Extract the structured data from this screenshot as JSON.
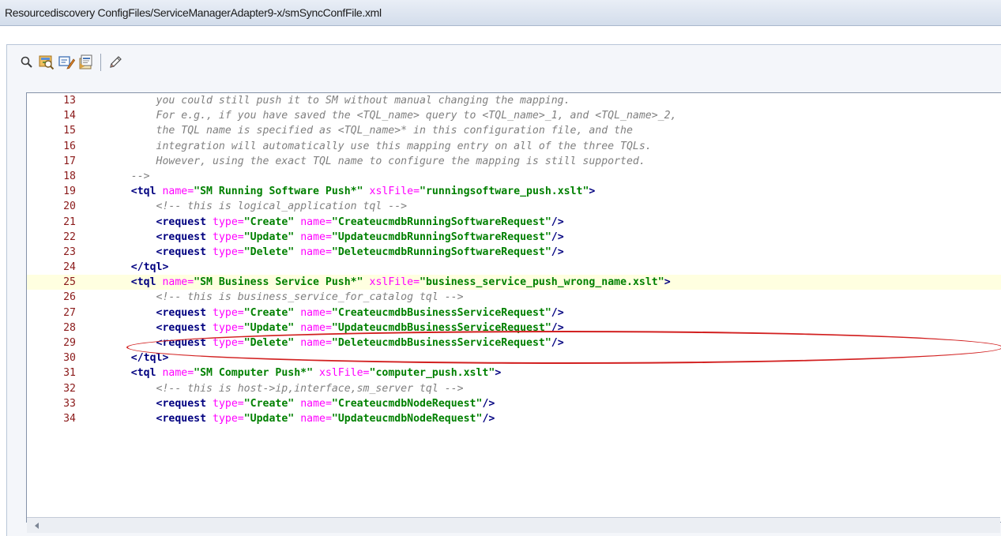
{
  "window": {
    "path": "Resourcediscovery ConfigFiles/ServiceManagerAdapter9-x/smSyncConfFile.xml"
  },
  "toolbar": {
    "buttons": [
      {
        "name": "search-icon"
      },
      {
        "name": "find-replace-icon"
      },
      {
        "name": "comment-icon"
      },
      {
        "name": "properties-icon"
      },
      {
        "name": "edit-pencil-icon"
      }
    ]
  },
  "editor": {
    "highlight_line": 25,
    "annotation_line": 25,
    "lines": [
      {
        "num": "13",
        "segments": [
          {
            "t": "comment",
            "s": "        you could still push it to SM without manual changing the mapping."
          }
        ]
      },
      {
        "num": "14",
        "segments": [
          {
            "t": "comment",
            "s": "        For e.g., if you have saved the <TQL_name> query to <TQL_name>_1, and <TQL_name>_2,"
          }
        ]
      },
      {
        "num": "15",
        "segments": [
          {
            "t": "comment",
            "s": "        the TQL name is specified as <TQL_name>* in this configuration file, and the"
          }
        ]
      },
      {
        "num": "16",
        "segments": [
          {
            "t": "comment",
            "s": "        integration will automatically use this mapping entry on all of the three TQLs."
          }
        ]
      },
      {
        "num": "17",
        "segments": [
          {
            "t": "comment",
            "s": "        However, using the exact TQL name to configure the mapping is still supported."
          }
        ]
      },
      {
        "num": "18",
        "segments": [
          {
            "t": "comment",
            "s": "    -->"
          }
        ]
      },
      {
        "num": "19",
        "segments": [
          {
            "t": "plain",
            "s": "    "
          },
          {
            "t": "tag",
            "s": "<tql "
          },
          {
            "t": "attr",
            "s": "name="
          },
          {
            "t": "val",
            "s": "\"SM Running Software Push*\""
          },
          {
            "t": "plain",
            "s": " "
          },
          {
            "t": "attr",
            "s": "xslFile="
          },
          {
            "t": "val",
            "s": "\"runningsoftware_push.xslt\""
          },
          {
            "t": "tag",
            "s": ">"
          }
        ]
      },
      {
        "num": "20",
        "segments": [
          {
            "t": "comment",
            "s": "        <!-- this is logical_application tql -->"
          }
        ]
      },
      {
        "num": "21",
        "segments": [
          {
            "t": "plain",
            "s": "        "
          },
          {
            "t": "tag",
            "s": "<request "
          },
          {
            "t": "attr",
            "s": "type="
          },
          {
            "t": "val",
            "s": "\"Create\""
          },
          {
            "t": "plain",
            "s": " "
          },
          {
            "t": "attr",
            "s": "name="
          },
          {
            "t": "val",
            "s": "\"CreateucmdbRunningSoftwareRequest\""
          },
          {
            "t": "tag",
            "s": "/>"
          }
        ]
      },
      {
        "num": "22",
        "segments": [
          {
            "t": "plain",
            "s": "        "
          },
          {
            "t": "tag",
            "s": "<request "
          },
          {
            "t": "attr",
            "s": "type="
          },
          {
            "t": "val",
            "s": "\"Update\""
          },
          {
            "t": "plain",
            "s": " "
          },
          {
            "t": "attr",
            "s": "name="
          },
          {
            "t": "val",
            "s": "\"UpdateucmdbRunningSoftwareRequest\""
          },
          {
            "t": "tag",
            "s": "/>"
          }
        ]
      },
      {
        "num": "23",
        "segments": [
          {
            "t": "plain",
            "s": "        "
          },
          {
            "t": "tag",
            "s": "<request "
          },
          {
            "t": "attr",
            "s": "type="
          },
          {
            "t": "val",
            "s": "\"Delete\""
          },
          {
            "t": "plain",
            "s": " "
          },
          {
            "t": "attr",
            "s": "name="
          },
          {
            "t": "val",
            "s": "\"DeleteucmdbRunningSoftwareRequest\""
          },
          {
            "t": "tag",
            "s": "/>"
          }
        ]
      },
      {
        "num": "24",
        "segments": [
          {
            "t": "plain",
            "s": "    "
          },
          {
            "t": "tag",
            "s": "</tql>"
          }
        ]
      },
      {
        "num": "25",
        "segments": [
          {
            "t": "plain",
            "s": "    "
          },
          {
            "t": "tag",
            "s": "<tql "
          },
          {
            "t": "attr",
            "s": "name="
          },
          {
            "t": "val",
            "s": "\"SM Business Service Push*\""
          },
          {
            "t": "plain",
            "s": " "
          },
          {
            "t": "attr",
            "s": "xslFile="
          },
          {
            "t": "val",
            "s": "\"business_service_push_wrong_name.xslt\""
          },
          {
            "t": "tag",
            "s": ">"
          }
        ]
      },
      {
        "num": "26",
        "segments": [
          {
            "t": "comment",
            "s": "        <!-- this is business_service_for_catalog tql -->"
          }
        ]
      },
      {
        "num": "27",
        "segments": [
          {
            "t": "plain",
            "s": "        "
          },
          {
            "t": "tag",
            "s": "<request "
          },
          {
            "t": "attr",
            "s": "type="
          },
          {
            "t": "val",
            "s": "\"Create\""
          },
          {
            "t": "plain",
            "s": " "
          },
          {
            "t": "attr",
            "s": "name="
          },
          {
            "t": "val",
            "s": "\"CreateucmdbBusinessServiceRequest\""
          },
          {
            "t": "tag",
            "s": "/>"
          }
        ]
      },
      {
        "num": "28",
        "segments": [
          {
            "t": "plain",
            "s": "        "
          },
          {
            "t": "tag",
            "s": "<request "
          },
          {
            "t": "attr",
            "s": "type="
          },
          {
            "t": "val",
            "s": "\"Update\""
          },
          {
            "t": "plain",
            "s": " "
          },
          {
            "t": "attr",
            "s": "name="
          },
          {
            "t": "val",
            "s": "\"UpdateucmdbBusinessServiceRequest\""
          },
          {
            "t": "tag",
            "s": "/>"
          }
        ]
      },
      {
        "num": "29",
        "segments": [
          {
            "t": "plain",
            "s": "        "
          },
          {
            "t": "tag",
            "s": "<request "
          },
          {
            "t": "attr",
            "s": "type="
          },
          {
            "t": "val",
            "s": "\"Delete\""
          },
          {
            "t": "plain",
            "s": " "
          },
          {
            "t": "attr",
            "s": "name="
          },
          {
            "t": "val",
            "s": "\"DeleteucmdbBusinessServiceRequest\""
          },
          {
            "t": "tag",
            "s": "/>"
          }
        ]
      },
      {
        "num": "30",
        "segments": [
          {
            "t": "plain",
            "s": "    "
          },
          {
            "t": "tag",
            "s": "</tql>"
          }
        ]
      },
      {
        "num": "31",
        "segments": [
          {
            "t": "plain",
            "s": "    "
          },
          {
            "t": "tag",
            "s": "<tql "
          },
          {
            "t": "attr",
            "s": "name="
          },
          {
            "t": "val",
            "s": "\"SM Computer Push*\""
          },
          {
            "t": "plain",
            "s": " "
          },
          {
            "t": "attr",
            "s": "xslFile="
          },
          {
            "t": "val",
            "s": "\"computer_push.xslt\""
          },
          {
            "t": "tag",
            "s": ">"
          }
        ]
      },
      {
        "num": "32",
        "segments": [
          {
            "t": "comment",
            "s": "        <!-- this is host->ip,interface,sm_server tql -->"
          }
        ]
      },
      {
        "num": "33",
        "segments": [
          {
            "t": "plain",
            "s": "        "
          },
          {
            "t": "tag",
            "s": "<request "
          },
          {
            "t": "attr",
            "s": "type="
          },
          {
            "t": "val",
            "s": "\"Create\""
          },
          {
            "t": "plain",
            "s": " "
          },
          {
            "t": "attr",
            "s": "name="
          },
          {
            "t": "val",
            "s": "\"CreateucmdbNodeRequest\""
          },
          {
            "t": "tag",
            "s": "/>"
          }
        ]
      },
      {
        "num": "34",
        "segments": [
          {
            "t": "plain",
            "s": "        "
          },
          {
            "t": "tag",
            "s": "<request "
          },
          {
            "t": "attr",
            "s": "type="
          },
          {
            "t": "val",
            "s": "\"Update\""
          },
          {
            "t": "plain",
            "s": " "
          },
          {
            "t": "attr",
            "s": "name="
          },
          {
            "t": "val",
            "s": "\"UpdateucmdbNodeRequest\""
          },
          {
            "t": "tag",
            "s": "/>"
          }
        ]
      }
    ]
  },
  "scrollbar": {
    "left_arrow_icon": "arrow-left-icon"
  }
}
